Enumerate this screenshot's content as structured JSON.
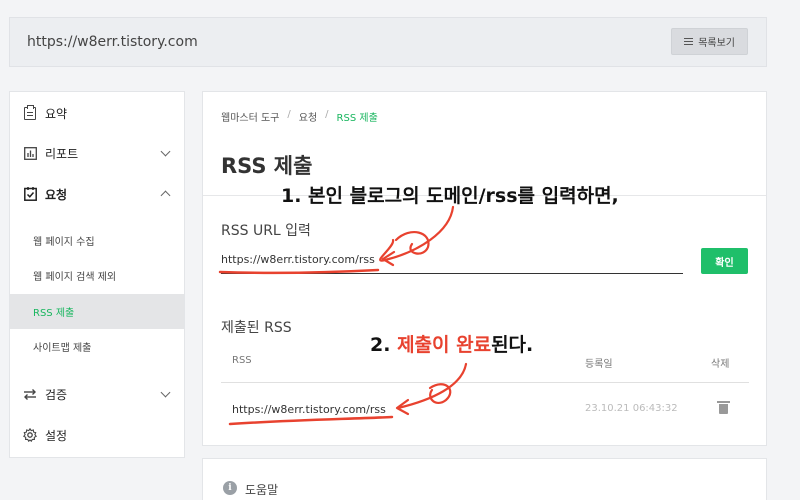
{
  "header": {
    "site_url": "https://w8err.tistory.com",
    "list_button": "목록보기"
  },
  "sidebar": {
    "items": [
      {
        "label": "요약",
        "icon": "clipboard-icon"
      },
      {
        "label": "리포트",
        "icon": "chart-icon"
      },
      {
        "label": "요청",
        "icon": "check-box-icon"
      },
      {
        "label": "검증",
        "icon": "swap-icon"
      },
      {
        "label": "설정",
        "icon": "gear-icon"
      }
    ],
    "sub_items": [
      {
        "label": "웹 페이지 수집"
      },
      {
        "label": "웹 페이지 검색 제외"
      },
      {
        "label": "RSS 제출"
      },
      {
        "label": "사이트맵 제출"
      }
    ]
  },
  "main": {
    "breadcrumb": [
      "웹마스터 도구",
      "요청",
      "RSS 제출"
    ],
    "title": "RSS 제출",
    "rss_url_label": "RSS URL 입력",
    "rss_input_value": "https://w8err.tistory.com/rss",
    "confirm_button": "확인",
    "submitted_label": "제출된 RSS",
    "table": {
      "headers": [
        "RSS",
        "등록일",
        "삭제"
      ],
      "rows": [
        {
          "url": "https://w8err.tistory.com/rss",
          "date": "23.10.21 06:43:32"
        }
      ]
    }
  },
  "help": {
    "label": "도움말"
  },
  "annotations": {
    "step1": "1. 본인 블로그의 도메인/rss를 입력하면,",
    "step2_prefix": "2. ",
    "step2_red": "제출이 완료",
    "step2_suffix": "된다."
  },
  "colors": {
    "accent": "#19b65f",
    "button_green": "#1fbf6a",
    "annotation_red": "#e8422f"
  }
}
